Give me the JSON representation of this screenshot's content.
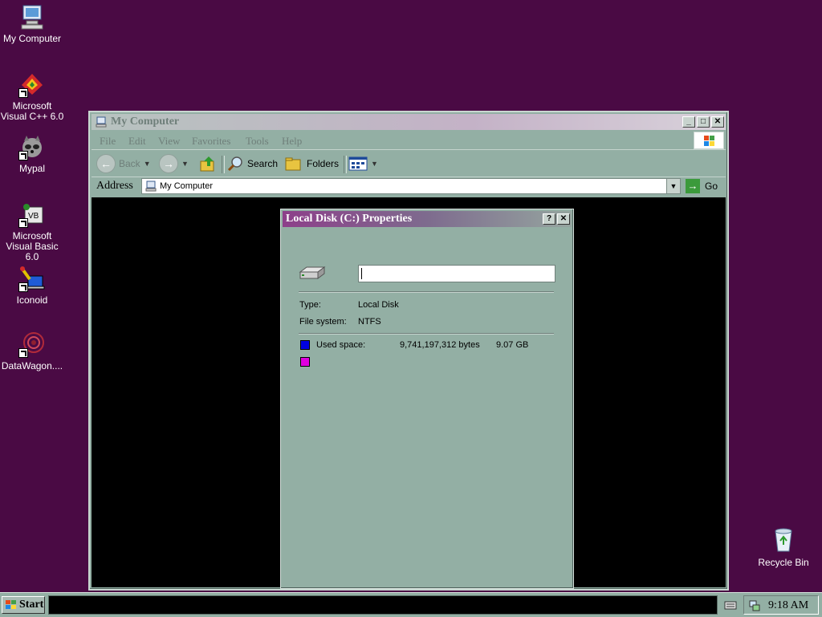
{
  "desktop": {
    "icons": [
      {
        "label": "My Computer"
      },
      {
        "label": "Microsoft Visual C++ 6.0"
      },
      {
        "label": "Mypal"
      },
      {
        "label": "Microsoft Visual Basic 6.0"
      },
      {
        "label": "Iconoid"
      },
      {
        "label": "DataWagon...."
      }
    ],
    "recycle_bin": "Recycle Bin"
  },
  "explorer": {
    "title": "My Computer",
    "controls": {
      "minimize": "_",
      "maximize": "□",
      "close": "✕"
    },
    "menu": [
      "File",
      "Edit",
      "View",
      "Favorites",
      "Tools",
      "Help"
    ],
    "toolbar": {
      "back": "Back",
      "search": "Search",
      "folders": "Folders"
    },
    "address": {
      "label": "Address",
      "value": "My Computer",
      "go": "Go"
    }
  },
  "properties": {
    "title": "Local Disk (C:) Properties",
    "help_button": "?",
    "close_button": "✕",
    "name_value": "",
    "type_label": "Type:",
    "type_value": "Local Disk",
    "fs_label": "File system:",
    "fs_value": "NTFS",
    "used_label": "Used space:",
    "used_bytes": "9,741,197,312 bytes",
    "used_gb": "9.07 GB",
    "used_color": "#0000e0",
    "free_color": "#e000e0"
  },
  "taskbar": {
    "start": "Start",
    "clock": "9:18 AM"
  },
  "colors": {
    "desktop": "#4a0a44",
    "window": "#93afa4",
    "dialog_title": "#8d3f8a"
  }
}
